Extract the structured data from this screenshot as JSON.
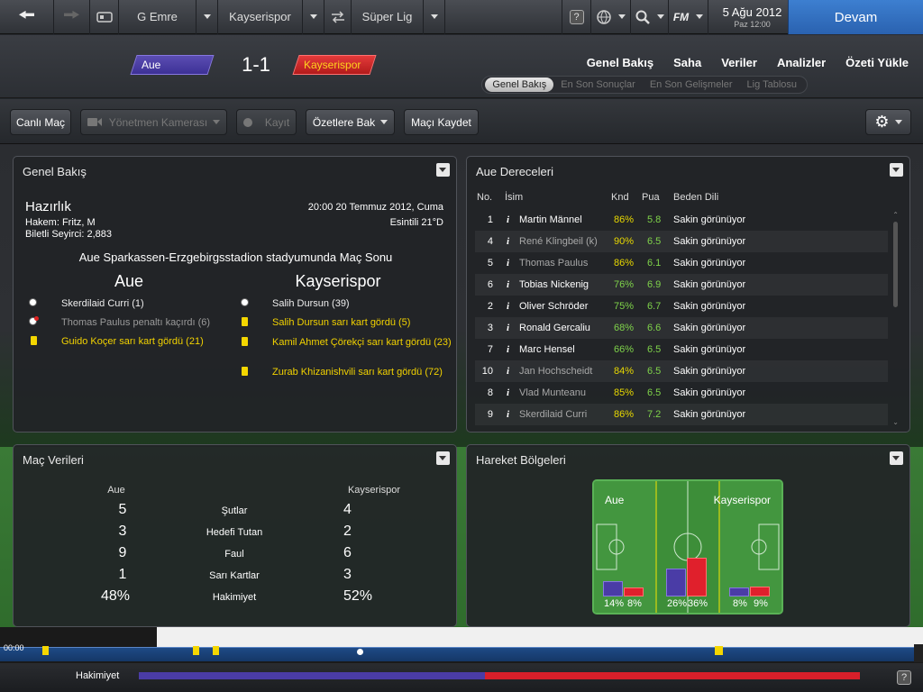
{
  "topbar": {
    "manager": "G Emre",
    "club": "Kayserispor",
    "competition": "Süper Lig",
    "help_label": "?",
    "fm_label": "FM",
    "date": "5 Ağu 2012",
    "time": "Paz 12:00",
    "continue_label": "Devam"
  },
  "match": {
    "home_team": "Aue",
    "away_team": "Kayserispor",
    "score": "1-1",
    "home_color": "#4a3ca6",
    "away_color": "#d22a2a"
  },
  "main_tabs": [
    "Genel Bakış",
    "Saha",
    "Veriler",
    "Analizler",
    "Özeti Yükle"
  ],
  "sub_tabs": [
    "Genel Bakış",
    "En Son Sonuçlar",
    "En Son Gelişmeler",
    "Lig Tablosu"
  ],
  "toolbar": {
    "live": "Canlı Maç",
    "camera": "Yönetmen Kamerası",
    "record": "Kayıt",
    "highlights": "Özetlere Bak",
    "save": "Maçı Kaydet"
  },
  "overview": {
    "title": "Genel Bakış",
    "status": "Hazırlık",
    "datetime": "20:00 20 Temmuz 2012, Cuma",
    "referee": "Hakem: Fritz, M",
    "weather": "Esintili 21°D",
    "attendance": "Biletli Seyirci: 2,883",
    "venue": "Aue Sparkassen-Erzgebirgsstadion stadyumunda Maç Sonu",
    "home_name": "Aue",
    "away_name": "Kayserispor",
    "home_events": [
      {
        "icon": "goal",
        "text": "Skerdilaid Curri (1)"
      },
      {
        "icon": "missed-penalty",
        "text": "Thomas Paulus penaltı kaçırdı (6)"
      },
      {
        "icon": "yellow-card",
        "text": "Guido Koçer sarı kart gördü (21)"
      }
    ],
    "away_events": [
      {
        "icon": "goal",
        "text": "Salih Dursun (39)"
      },
      {
        "icon": "yellow-card",
        "text": "Salih Dursun sarı kart gördü (5)"
      },
      {
        "icon": "yellow-card",
        "text": "Kamil Ahmet Çörekçi sarı kart gördü (23)"
      },
      {
        "icon": "yellow-card",
        "text": "Zurab Khizanishvili sarı kart gördü (72)"
      }
    ]
  },
  "ratings": {
    "title": "Aue Dereceleri",
    "headers": [
      "No.",
      "İsim",
      "Knd",
      "Pua",
      "Beden Dili"
    ],
    "rows": [
      {
        "no": "1",
        "name": "Martin Männel",
        "knd": "86%",
        "pua": "5.8",
        "body": "Sakin görünüyor"
      },
      {
        "no": "4",
        "name": "René Klingbeil (k)",
        "knd": "90%",
        "pua": "6.5",
        "body": "Sakin görünüyor"
      },
      {
        "no": "5",
        "name": "Thomas Paulus",
        "knd": "86%",
        "pua": "6.1",
        "body": "Sakin görünüyor"
      },
      {
        "no": "6",
        "name": "Tobias Nickenig",
        "knd": "76%",
        "pua": "6.9",
        "body": "Sakin görünüyor"
      },
      {
        "no": "2",
        "name": "Oliver Schröder",
        "knd": "75%",
        "pua": "6.7",
        "body": "Sakin görünüyor"
      },
      {
        "no": "3",
        "name": "Ronald Gercaliu",
        "knd": "68%",
        "pua": "6.6",
        "body": "Sakin görünüyor"
      },
      {
        "no": "7",
        "name": "Marc Hensel",
        "knd": "66%",
        "pua": "6.5",
        "body": "Sakin görünüyor"
      },
      {
        "no": "10",
        "name": "Jan Hochscheidt",
        "knd": "84%",
        "pua": "6.5",
        "body": "Sakin görünüyor"
      },
      {
        "no": "8",
        "name": "Vlad Munteanu",
        "knd": "85%",
        "pua": "6.5",
        "body": "Sakin görünüyor"
      },
      {
        "no": "9",
        "name": "Skerdilaid Curri",
        "knd": "86%",
        "pua": "7.2",
        "body": "Sakin görünüyor"
      }
    ]
  },
  "match_data": {
    "title": "Maç Verileri",
    "home_label": "Aue",
    "away_label": "Kayserispor",
    "stats": [
      {
        "label": "Şutlar",
        "home": "5",
        "away": "4"
      },
      {
        "label": "Hedefi Tutan",
        "home": "3",
        "away": "2"
      },
      {
        "label": "Faul",
        "home": "9",
        "away": "6"
      },
      {
        "label": "Sarı Kartlar",
        "home": "1",
        "away": "3"
      },
      {
        "label": "Hakimiyet",
        "home": "48%",
        "away": "52%"
      }
    ]
  },
  "zones": {
    "title": "Hareket Bölgeleri",
    "home_label": "Aue",
    "away_label": "Kayserispor",
    "thirds": [
      {
        "home": "14%",
        "away": "8%",
        "home_v": 14,
        "away_v": 8
      },
      {
        "home": "26%",
        "away": "36%",
        "home_v": 26,
        "away_v": 36
      },
      {
        "home": "8%",
        "away": "9%",
        "home_v": 8,
        "away_v": 9
      }
    ]
  },
  "footer": {
    "time": "00:00",
    "possession_label": "Hakimiyet",
    "home_possession": 48,
    "help_label": "?"
  }
}
